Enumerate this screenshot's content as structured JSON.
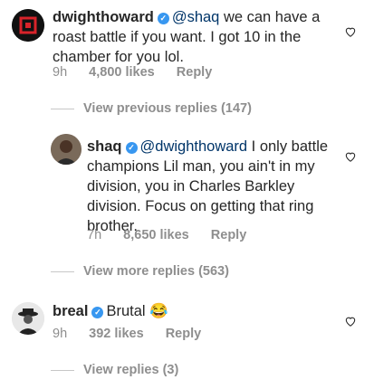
{
  "comments": [
    {
      "username": "dwighthoward",
      "mention": "@shaq",
      "text": " we can have a roast battle if you want. I got 10 in the chamber for you lol.",
      "time": "9h",
      "likes": "4,800 likes",
      "reply": "Reply"
    },
    {
      "username": "shaq",
      "mention": "@dwighthoward",
      "text": " I only battle champions Lil man, you ain't in my division, you in Charles Barkley division. Focus on getting that ring brother.",
      "time": "7h",
      "likes": "8,650 likes",
      "reply": "Reply"
    },
    {
      "username": "breal",
      "text": "Brutal 😂",
      "time": "9h",
      "likes": "392 likes",
      "reply": "Reply"
    }
  ],
  "view_previous_replies": "View previous replies (147)",
  "view_more_replies": "View more replies (563)",
  "view_replies": "View replies (3)",
  "colors": {
    "verified": "#3897f0",
    "mention": "#003569",
    "meta": "#8e8e8e",
    "avatar1": "#d8232a"
  }
}
